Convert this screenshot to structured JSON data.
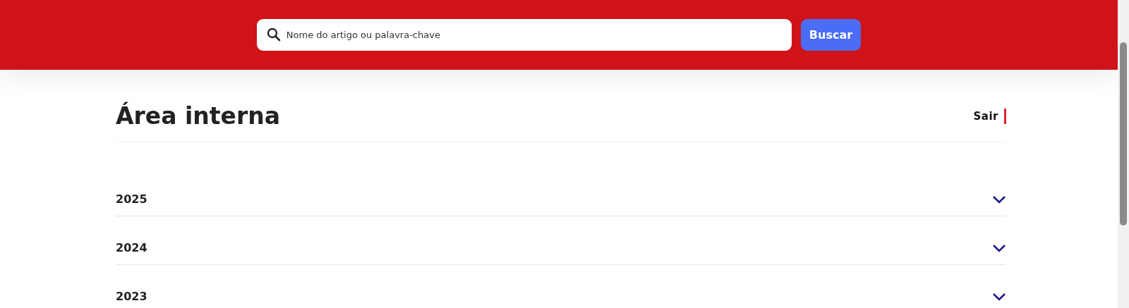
{
  "header": {
    "search": {
      "placeholder": "Nome do artigo ou palavra-chave"
    },
    "button": "Buscar"
  },
  "page": {
    "title": "Área interna",
    "logout": "Sair"
  },
  "years": [
    {
      "label": "2025",
      "expanded": false
    },
    {
      "label": "2024",
      "expanded": false
    },
    {
      "label": "2023",
      "expanded": false
    }
  ]
}
